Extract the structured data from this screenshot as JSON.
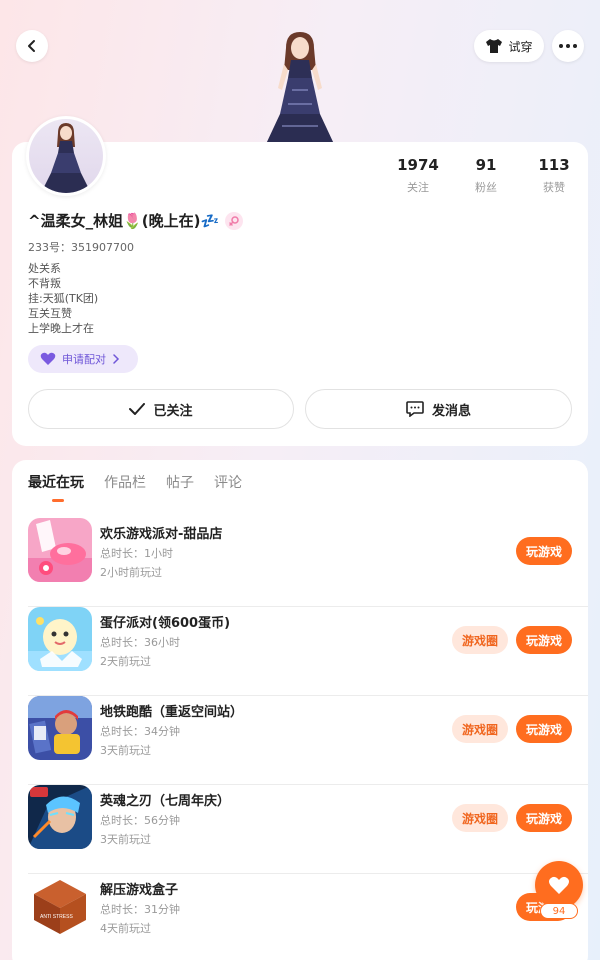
{
  "header": {
    "back_icon": "chevron-left-icon",
    "tryon_label": "试穿",
    "tryon_icon": "tshirt-icon",
    "more_icon": "more-dots-icon"
  },
  "profile": {
    "nickname": "^温柔女_林姐🌷(晚上在)💤",
    "gender_icon": "female-icon",
    "user_id": "233号：351907700",
    "bio_lines": [
      "处关系",
      "不背叛",
      "挂:天狐(TK团)",
      "互关互赞",
      "上学晚上才在"
    ],
    "stats": [
      {
        "value": "1974",
        "label": "关注"
      },
      {
        "value": "91",
        "label": "粉丝"
      },
      {
        "value": "113",
        "label": "获赞"
      }
    ],
    "pair_button": "申请配对",
    "follow_button": "已关注",
    "message_button": "发消息"
  },
  "tabs": [
    {
      "label": "最近在玩",
      "active": true
    },
    {
      "label": "作品栏",
      "active": false
    },
    {
      "label": "帖子",
      "active": false
    },
    {
      "label": "评论",
      "active": false
    }
  ],
  "games": [
    {
      "title": "欢乐游戏派对-甜品店",
      "duration": "总时长：1小时",
      "last_played": "2小时前玩过",
      "circle_button": null,
      "play_button": "玩游戏",
      "icon": "candy-shop-game-icon"
    },
    {
      "title": "蛋仔派对(领600蛋币)",
      "duration": "总时长：36小时",
      "last_played": "2天前玩过",
      "circle_button": "游戏圈",
      "play_button": "玩游戏",
      "icon": "egg-party-game-icon"
    },
    {
      "title": "地铁跑酷（重返空间站）",
      "duration": "总时长：34分钟",
      "last_played": "3天前玩过",
      "circle_button": "游戏圈",
      "play_button": "玩游戏",
      "icon": "subway-surfers-game-icon"
    },
    {
      "title": "英魂之刃（七周年庆）",
      "duration": "总时长：56分钟",
      "last_played": "3天前玩过",
      "circle_button": "游戏圈",
      "play_button": "玩游戏",
      "icon": "hero-blade-game-icon"
    },
    {
      "title": "解压游戏盒子",
      "duration": "总时长：31分钟",
      "last_played": "4天前玩过",
      "circle_button": null,
      "play_button": "玩游戏",
      "icon": "anti-stress-game-icon",
      "icon_text": "ANTI STRESS"
    }
  ],
  "like": {
    "icon": "heart-icon",
    "count": "94"
  },
  "colors": {
    "accent": "#ff6d1f",
    "pair_purple": "#6f56d8"
  }
}
